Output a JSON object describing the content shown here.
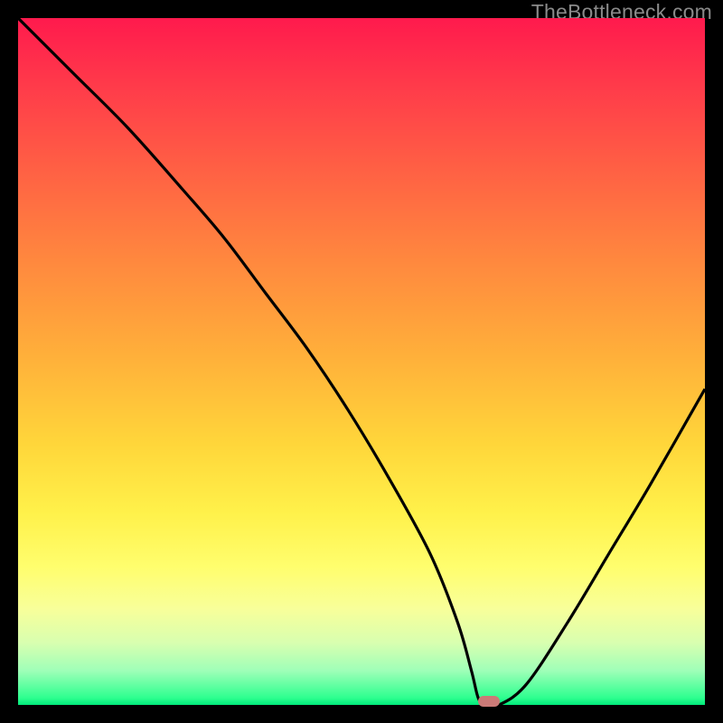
{
  "watermark": "TheBottleneck.com",
  "colors": {
    "curve": "#000000",
    "marker": "#cb7a77",
    "frame": "#000000"
  },
  "chart_data": {
    "type": "line",
    "title": "",
    "xlabel": "",
    "ylabel": "",
    "xlim": [
      0,
      100
    ],
    "ylim": [
      0,
      100
    ],
    "grid": false,
    "legend": false,
    "series": [
      {
        "name": "bottleneck-curve",
        "x": [
          0,
          8,
          16,
          24,
          30,
          36,
          42,
          48,
          54,
          60,
          64,
          66,
          67,
          68,
          70,
          74,
          80,
          86,
          92,
          100
        ],
        "values": [
          100,
          92,
          84,
          75,
          68,
          60,
          52,
          43,
          33,
          22,
          12,
          5,
          1,
          0,
          0,
          3,
          12,
          22,
          32,
          46
        ]
      }
    ],
    "marker": {
      "x": 68.5,
      "y": 0,
      "label": ""
    },
    "annotations": []
  }
}
